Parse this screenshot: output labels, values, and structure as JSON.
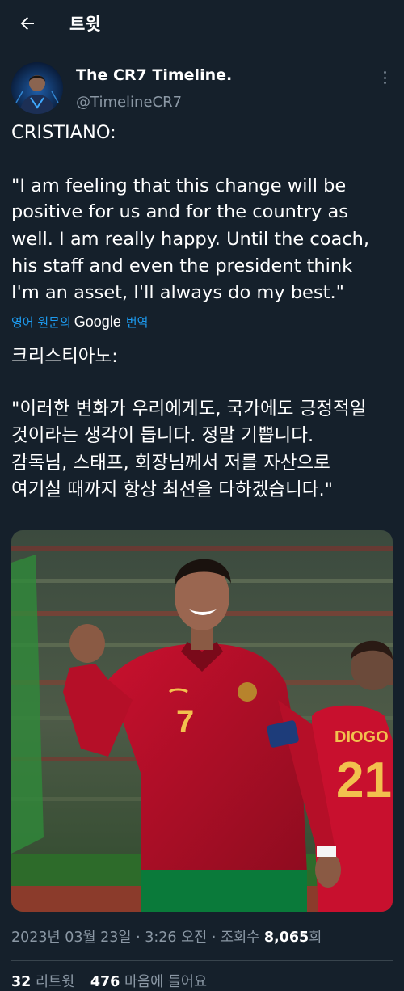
{
  "header": {
    "title": "트윗",
    "back_icon": "arrow-left-icon"
  },
  "author": {
    "display_name": "The CR7 Timeline.",
    "handle": "@TimelineCR7",
    "avatar_icon": "avatar"
  },
  "tweet": {
    "lines_en": [
      "CRISTIANO:",
      "\"I am feeling that this change will be",
      "positive for us and for the country as",
      "well. I am really happy. Until the coach,",
      "his staff and even the president think",
      "I'm an asset, I'll always do my best.\""
    ],
    "translate_prefix": "영어 원문의",
    "translate_brand": "Google",
    "translate_suffix": "번역",
    "lines_ko": [
      "크리스티아노:",
      "\"이러한 변화가 우리에게도, 국가에도 긍정적일",
      "것이라는 생각이 듭니다. 정말 기쁩니다.",
      "감독님, 스태프, 회장님께서 저를 자산으로",
      "여기실 때까지 항상 최선을 다하겠습니다.\""
    ]
  },
  "photo": {
    "jersey_number": "7",
    "teammate_name": "DIOGO J.",
    "teammate_number": "21"
  },
  "meta": {
    "date": "2023년 03월 23일",
    "sep1": " · ",
    "time": "3:26 오전",
    "sep2": " · ",
    "views_label": "조회수 ",
    "views_count": "8,065",
    "views_suffix": "회"
  },
  "stats": {
    "retweets_count": "32",
    "retweets_label": "리트윗",
    "likes_count": "476",
    "likes_label": "마음에 들어요"
  },
  "colors": {
    "background": "#15202b",
    "link": "#1d9bf0",
    "secondary_text": "#8b98a5"
  }
}
